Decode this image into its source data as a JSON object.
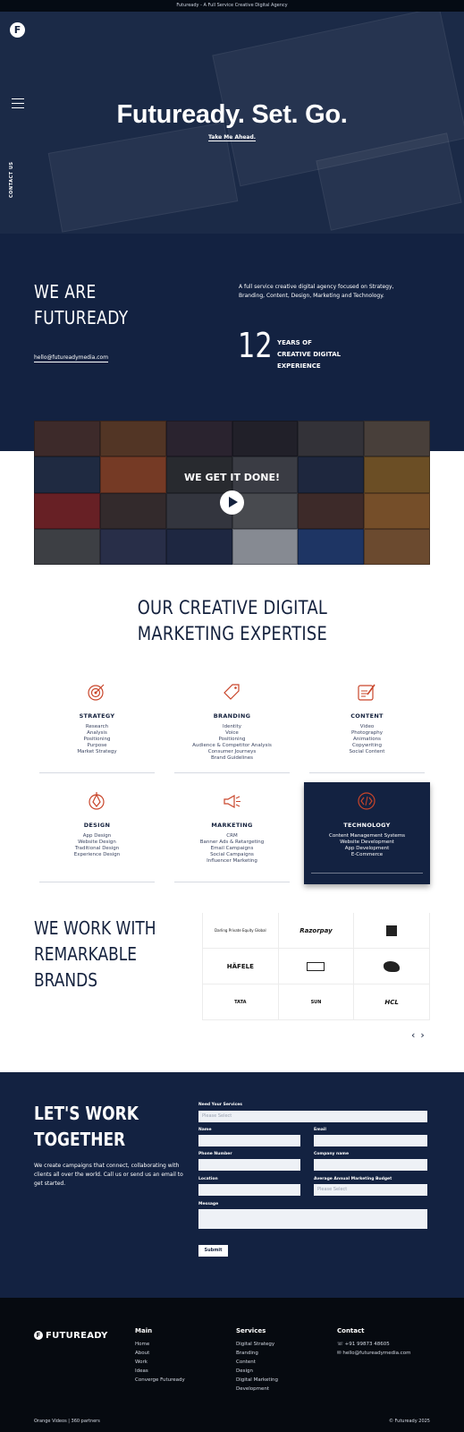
{
  "topbar": {
    "text": "Futuready - A Full Service Creative Digital Agency"
  },
  "hero": {
    "logo_letter": "F",
    "contact_label": "CONTACT US",
    "headline": "Futuready. Set. Go.",
    "tagline": "Take Me Ahead."
  },
  "about": {
    "heading_line1": "WE ARE",
    "heading_line2": "FUTUREADY",
    "email": "hello@futureadymedia.com",
    "description": "A full service creative digital agency focused on Strategy, Branding, Content, Design, Marketing and Technology.",
    "years_number": "12",
    "years_line1": "YEARS OF",
    "years_line2": "CREATIVE DIGITAL",
    "years_line3": "EXPERIENCE"
  },
  "video": {
    "title": "WE GET IT DONE!"
  },
  "expertise": {
    "title_line1": "OUR CREATIVE DIGITAL",
    "title_line2": "MARKETING EXPERTISE",
    "accent": "#c9452a",
    "cards": [
      {
        "title": "STRATEGY",
        "icon": "target-icon",
        "items": [
          "Research",
          "Analysis",
          "Positioning",
          "Purpose",
          "Market Strategy"
        ]
      },
      {
        "title": "BRANDING",
        "icon": "tag-icon",
        "items": [
          "Identity",
          "Voice",
          "Positioning",
          "Audience & Competitor Analysis",
          "Consumer Journeys",
          "Brand Guidelines"
        ]
      },
      {
        "title": "CONTENT",
        "icon": "pencil-note-icon",
        "items": [
          "Video",
          "Photography",
          "Animations",
          "Copywriting",
          "Social Content"
        ]
      },
      {
        "title": "DESIGN",
        "icon": "pen-tool-icon",
        "items": [
          "App Design",
          "Website Design",
          "Traditional Design",
          "Experience Design"
        ]
      },
      {
        "title": "MARKETING",
        "icon": "megaphone-icon",
        "items": [
          "CRM",
          "Banner Ads & Retargeting",
          "Email Campaigns",
          "Social Campaigns",
          "Influencer Marketing"
        ]
      },
      {
        "title": "TECHNOLOGY",
        "icon": "code-icon",
        "items": [
          "Content Management Systems",
          "Website Development",
          "App Development",
          "E-Commerce"
        ]
      }
    ]
  },
  "brands": {
    "title_line1": "WE WORK WITH",
    "title_line2": "REMARKABLE",
    "title_line3": "BRANDS",
    "logos": [
      "Darling Private Equity Global",
      "Razorpay",
      "",
      "HÄFELE",
      "",
      "",
      "TATA",
      "SUN",
      "HCL"
    ],
    "prev": "‹",
    "next": "›"
  },
  "contact": {
    "heading_line1": "LET'S WORK",
    "heading_line2": "TOGETHER",
    "text": "We create campaigns that connect, collaborating with clients all over the world. Call us or send us an email to get started.",
    "services_label": "Need Your Services",
    "services_placeholder": "Please Select",
    "name_label": "Name",
    "email_label": "Email",
    "phone_label": "Phone Number",
    "company_label": "Company name",
    "location_label": "Location",
    "budget_label": "Average Annual Marketing Budget",
    "budget_placeholder": "Please Select",
    "message_label": "Message",
    "submit_label": "Submit"
  },
  "footer": {
    "logo_text": "FUTUREADY",
    "main_title": "Main",
    "main_links": [
      "Home",
      "About",
      "Work",
      "Ideas",
      "Converge Futuready"
    ],
    "services_title": "Services",
    "services_links": [
      "Digital Strategy",
      "Branding",
      "Content",
      "Design",
      "Digital Marketing",
      "Development"
    ],
    "contact_title": "Contact",
    "phone": "+91 99873 48605",
    "email": "hello@futureadymedia.com",
    "copy_left": "Orange Videos | 360 partners",
    "copy_right": "© Futuready 2025"
  }
}
